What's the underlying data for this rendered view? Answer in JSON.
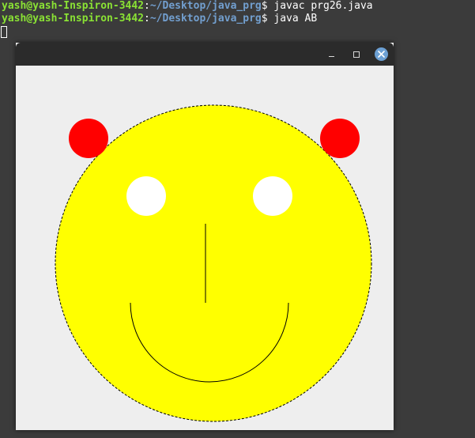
{
  "terminal": {
    "lines": [
      {
        "user": "yash@yash-Inspiron-3442",
        "sep": ":",
        "path": "~/Desktop/java_prg",
        "prompt": "$ ",
        "cmd": "javac prg26.java"
      },
      {
        "user": "yash@yash-Inspiron-3442",
        "sep": ":",
        "path": "~/Desktop/java_prg",
        "prompt": "$ ",
        "cmd": "java AB"
      }
    ],
    "colors": {
      "user": "#8ae234",
      "path": "#729fcf",
      "text": "#ffffff",
      "background": "#3b3b3b"
    }
  },
  "window": {
    "buttons": {
      "minimize": "minimize-icon",
      "maximize": "maximize-icon",
      "close": "close-icon"
    },
    "close_color": "#6ca0d4",
    "titlebar_color": "#2b2b2b",
    "canvas_color": "#eeeeee"
  },
  "drawing": {
    "face_color": "#ffff00",
    "ear_color": "#ff0000",
    "eye_color": "#ffffff",
    "outline_color": "#000000"
  }
}
